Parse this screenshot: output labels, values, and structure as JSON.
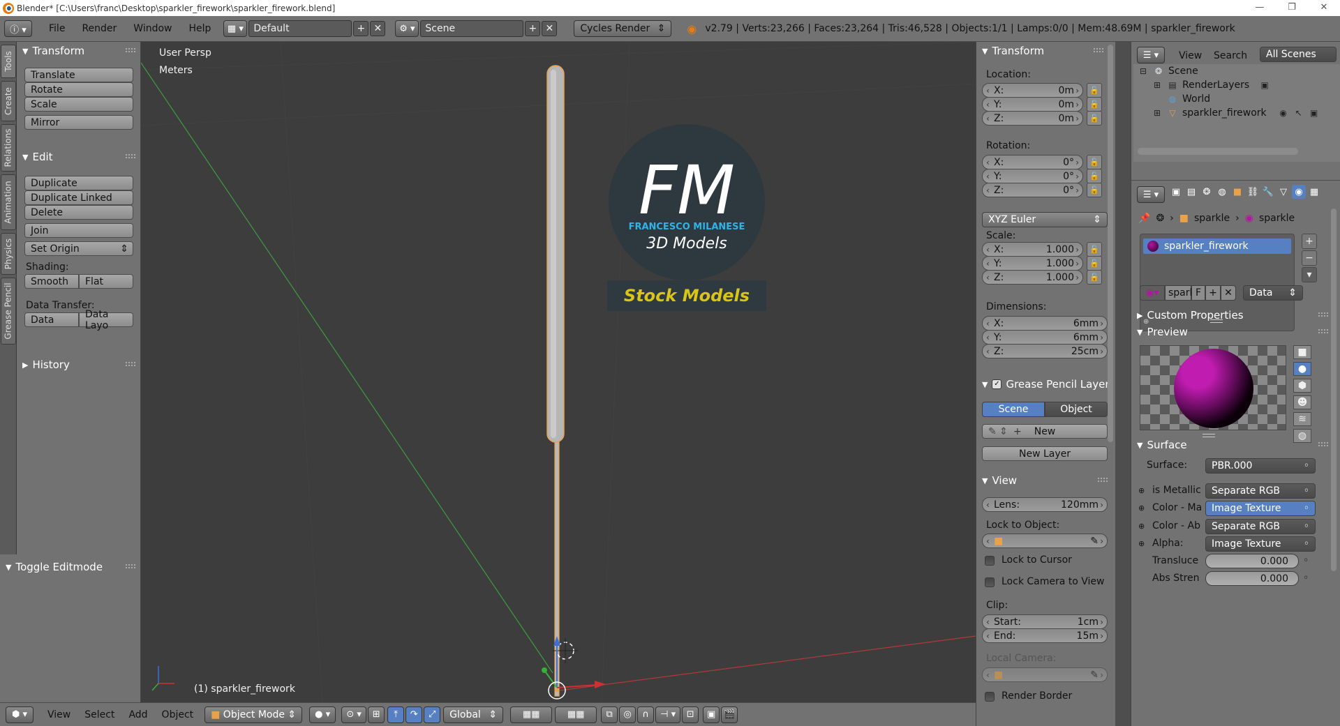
{
  "title_bar": {
    "text": "Blender* [C:\\Users\\franc\\Desktop\\sparkler_firework\\sparkler_firework.blend]",
    "minimize": "—",
    "maximize": "❐",
    "close": "✕"
  },
  "info_header": {
    "menus": [
      "File",
      "Render",
      "Window",
      "Help"
    ],
    "screen_layout": "Default",
    "scene": "Scene",
    "render_engine": "Cycles Render",
    "stats": "v2.79 | Verts:23,266 | Faces:23,264 | Tris:46,528 | Objects:1/1 | Lamps:0/0 | Mem:48.69M | sparkler_firework"
  },
  "tool_tabs": [
    "Tools",
    "Create",
    "Relations",
    "Animation",
    "Physics",
    "Grease Pencil"
  ],
  "tool_shelf": {
    "transform": {
      "title": "Transform",
      "buttons": [
        "Translate",
        "Rotate",
        "Scale",
        "Mirror"
      ]
    },
    "edit": {
      "title": "Edit",
      "buttons": [
        "Duplicate",
        "Duplicate Linked",
        "Delete",
        "Join"
      ],
      "set_origin": "Set Origin",
      "shading_label": "Shading:",
      "smooth": "Smooth",
      "flat": "Flat",
      "data_transfer_label": "Data Transfer:",
      "data": "Data",
      "data_layout": "Data Layo"
    },
    "history": "History",
    "toggle_editmode": "Toggle Editmode"
  },
  "viewport": {
    "view_name": "User Persp",
    "units": "Meters",
    "object_label": "(1) sparkler_firework",
    "watermark": {
      "initials": "FM",
      "name": "FRANCESCO MILANESE",
      "subtitle": "3D Models",
      "banner": "Stock Models"
    }
  },
  "viewport_header": {
    "menus": [
      "View",
      "Select",
      "Add",
      "Object"
    ],
    "mode": "Object Mode",
    "orientation": "Global"
  },
  "properties_panel": {
    "transform_title": "Transform",
    "location_label": "Location:",
    "location": [
      {
        "axis": "X:",
        "value": "0m"
      },
      {
        "axis": "Y:",
        "value": "0m"
      },
      {
        "axis": "Z:",
        "value": "0m"
      }
    ],
    "rotation_label": "Rotation:",
    "rotation": [
      {
        "axis": "X:",
        "value": "0°"
      },
      {
        "axis": "Y:",
        "value": "0°"
      },
      {
        "axis": "Z:",
        "value": "0°"
      }
    ],
    "rotation_mode": "XYZ Euler",
    "scale_label": "Scale:",
    "scale": [
      {
        "axis": "X:",
        "value": "1.000"
      },
      {
        "axis": "Y:",
        "value": "1.000"
      },
      {
        "axis": "Z:",
        "value": "1.000"
      }
    ],
    "dimensions_label": "Dimensions:",
    "dimensions": [
      {
        "axis": "X:",
        "value": "6mm"
      },
      {
        "axis": "Y:",
        "value": "6mm"
      },
      {
        "axis": "Z:",
        "value": "25cm"
      }
    ],
    "grease_pencil_title": "Grease Pencil Layer",
    "gp_scene": "Scene",
    "gp_object": "Object",
    "gp_new": "New",
    "gp_new_layer": "New Layer",
    "view_title": "View",
    "lens_label": "Lens:",
    "lens_value": "120mm",
    "lock_to_object_label": "Lock to Object:",
    "lock_to_cursor": "Lock to Cursor",
    "lock_camera": "Lock Camera to View",
    "clip_label": "Clip:",
    "clip_start_label": "Start:",
    "clip_start": "1cm",
    "clip_end_label": "End:",
    "clip_end": "15m",
    "local_camera_label": "Local Camera:",
    "render_border": "Render Border"
  },
  "outliner": {
    "menus": [
      "View",
      "Search"
    ],
    "filter": "All Scenes",
    "items": [
      {
        "label": "Scene"
      },
      {
        "label": "RenderLayers"
      },
      {
        "label": "World"
      },
      {
        "label": "sparkler_firework"
      }
    ]
  },
  "material_props": {
    "breadcrumb_object": "sparkle",
    "breadcrumb_material": "sparkle",
    "slot": "sparkler_firework",
    "material_name": "spark",
    "fake_user": "F",
    "link": "Data",
    "custom_properties": "Custom Properties",
    "preview": "Preview",
    "surface_title": "Surface",
    "surface_label": "Surface:",
    "surface_value": "PBR.000",
    "inputs": [
      {
        "label": "is Metallic",
        "value": "Separate RGB",
        "highlight": false
      },
      {
        "label": "Color - Ma",
        "value": "Image Texture",
        "highlight": true
      },
      {
        "label": "Color - Ab",
        "value": "Separate RGB",
        "highlight": false
      },
      {
        "label": "Alpha:",
        "value": "Image Texture",
        "highlight": false
      }
    ],
    "translucency_label": "Transluce",
    "translucency_value": "0.000",
    "abs_strength_label": "Abs Stren",
    "abs_strength_value": "0.000"
  },
  "colors": {
    "viewport_bg": "#3d3d3d",
    "panel_bg": "#727272",
    "selection_blue": "#5680c2",
    "fm_blue": "#2fb3e8",
    "banner_yellow": "#d9c418",
    "preview_magenta": "#b0169e"
  }
}
